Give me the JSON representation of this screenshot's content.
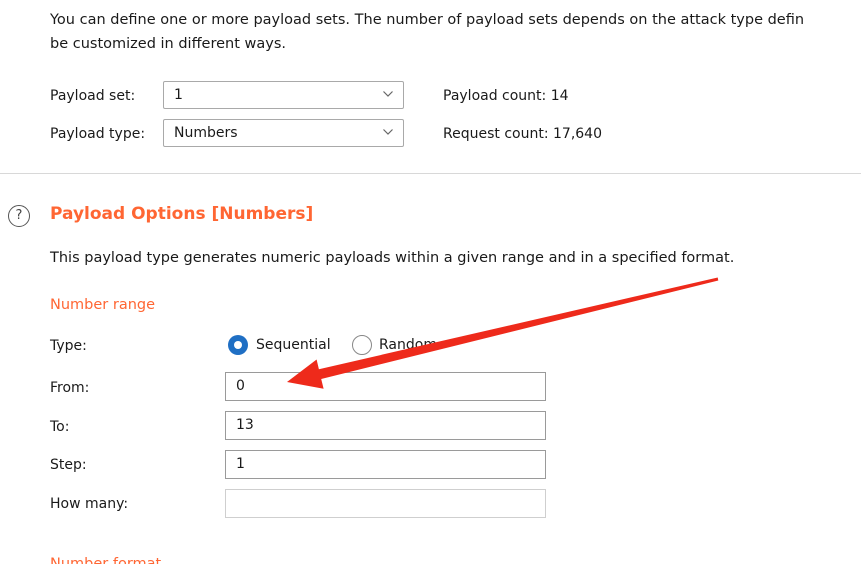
{
  "intro": {
    "line1": "You can define one or more payload sets. The number of payload sets depends on the attack type defin",
    "line2": "be customized in different ways."
  },
  "payload_set": {
    "label": "Payload set:",
    "value": "1",
    "count_label": "Payload count:",
    "count_value": "14"
  },
  "payload_type": {
    "label": "Payload type:",
    "value": "Numbers",
    "request_label": "Request count:",
    "request_value": "17,640"
  },
  "options": {
    "help_icon": "help-circle-icon",
    "title": "Payload Options [Numbers]",
    "description": "This payload type generates numeric payloads within a given range and in a specified format.",
    "range_title": "Number range",
    "type_label": "Type:",
    "radio_sequential": "Sequential",
    "radio_random": "Random",
    "from_label": "From:",
    "from_value": "0",
    "to_label": "To:",
    "to_value": "13",
    "step_label": "Step:",
    "step_value": "1",
    "how_many_label": "How many:",
    "how_many_value": "",
    "next_section": "Number format"
  },
  "annotation": {
    "arrow_color": "#ee2a1b"
  },
  "colors": {
    "accent": "#ff6633",
    "radio_selected": "#1f6fc4"
  }
}
